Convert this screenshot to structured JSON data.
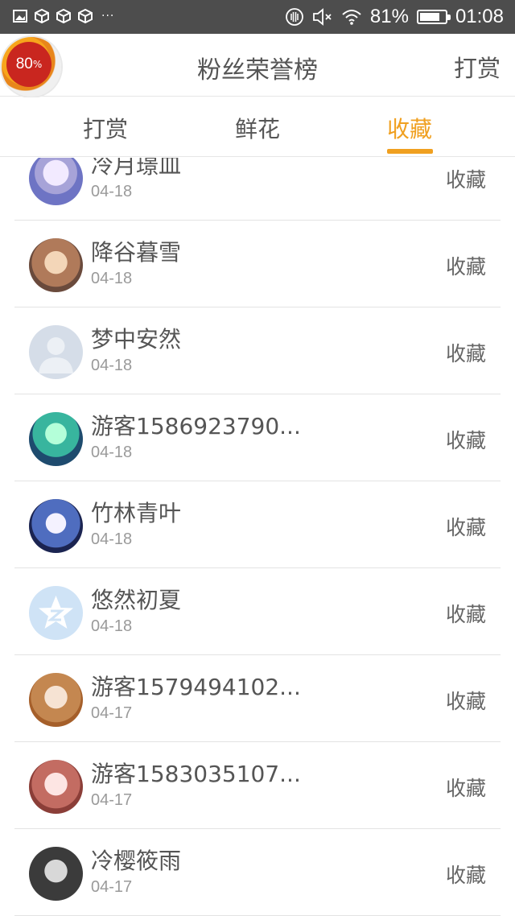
{
  "status_bar": {
    "icons": [
      "image-icon",
      "package-icon",
      "package-icon",
      "package-icon"
    ],
    "more": "···",
    "battery_percent": "81%",
    "battery_level": 0.81,
    "time": "01:08",
    "right_icons": [
      "nfc-icon",
      "mute-icon",
      "wifi-icon",
      "battery-icon"
    ]
  },
  "header": {
    "badge_value": "80",
    "badge_unit": "%",
    "title": "粉丝荣誉榜",
    "action_label": "打赏"
  },
  "tabs": [
    {
      "label": "打赏",
      "active": false
    },
    {
      "label": "鲜花",
      "active": false
    },
    {
      "label": "收藏",
      "active": true
    }
  ],
  "accent_color": "#f0a020",
  "fans": [
    {
      "name": "冷月璟皿",
      "date": "04-18",
      "action": "收藏"
    },
    {
      "name": "降谷暮雪",
      "date": "04-18",
      "action": "收藏"
    },
    {
      "name": "梦中安然",
      "date": "04-18",
      "action": "收藏"
    },
    {
      "name": "游客1586923790...",
      "date": "04-18",
      "action": "收藏"
    },
    {
      "name": "竹林青叶",
      "date": "04-18",
      "action": "收藏"
    },
    {
      "name": "悠然初夏",
      "date": "04-18",
      "action": "收藏"
    },
    {
      "name": "游客1579494102...",
      "date": "04-17",
      "action": "收藏"
    },
    {
      "name": "游客1583035107...",
      "date": "04-17",
      "action": "收藏"
    },
    {
      "name": "冷樱筱雨",
      "date": "04-17",
      "action": "收藏"
    }
  ]
}
